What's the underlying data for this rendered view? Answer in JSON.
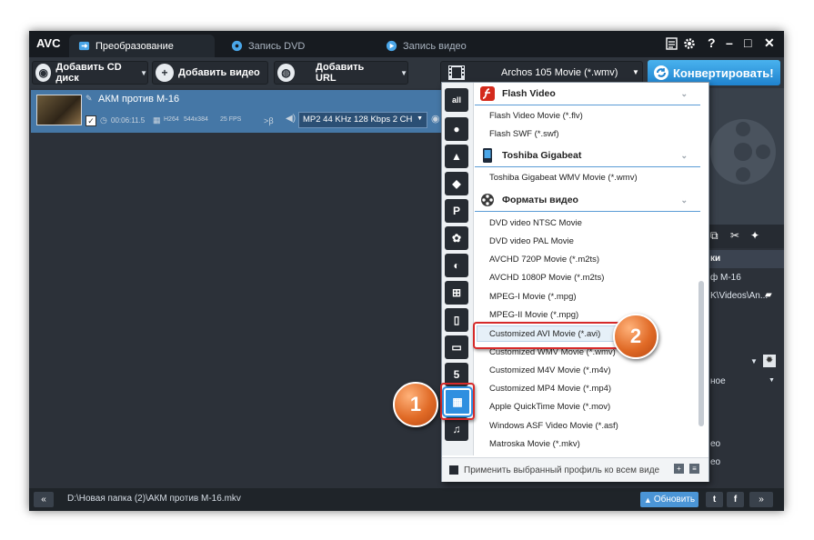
{
  "app": {
    "logo": "AVC",
    "tabs": [
      {
        "label": "Преобразование",
        "icon": "convert-icon",
        "active": true
      },
      {
        "label": "Запись DVD",
        "icon": "disc-icon",
        "active": false
      },
      {
        "label": "Запись видео",
        "icon": "play-icon",
        "active": false
      }
    ],
    "window_controls": {
      "help": "?",
      "minimize": "–",
      "maximize": "□",
      "close": "✕"
    }
  },
  "toolbar": {
    "add_cd": "Добавить CD диск",
    "add_video": "Добавить видео",
    "add_url": "Добавить URL",
    "profile": "Archos 105 Movie (*.wmv)",
    "convert": "Конвертировать!"
  },
  "file": {
    "name": "АКМ против М-16",
    "duration": "00:06:11.5",
    "codec": "H264",
    "resolution": "544x384",
    "fps": "25 FPS",
    "audio": "MP2 44 KHz 128 Kbps 2 CH"
  },
  "right_panel": {
    "header": "ки",
    "name_value": "ф М-16",
    "path_value": "K\\Videos\\An...",
    "option_value": "ное",
    "label_1": "ео",
    "label_2": "ео"
  },
  "dropdown": {
    "groups": [
      {
        "label": "Flash Video",
        "items": [
          "Flash Video Movie (*.flv)",
          "Flash SWF (*.swf)"
        ]
      },
      {
        "label": "Toshiba Gigabeat",
        "items": [
          "Toshiba Gigabeat WMV Movie (*.wmv)"
        ]
      },
      {
        "label": "Форматы видео",
        "items": [
          "DVD video NTSC Movie",
          "DVD video PAL Movie",
          "AVCHD 720P Movie (*.m2ts)",
          "AVCHD 1080P Movie (*.m2ts)",
          "MPEG-I Movie (*.mpg)",
          "MPEG-II Movie (*.mpg)",
          "Customized AVI Movie (*.avi)",
          "Customized WMV Movie (*.wmv)",
          "Customized M4V Movie (*.m4v)",
          "Customized MP4 Movie (*.mp4)",
          "Apple QuickTime Movie (*.mov)",
          "Windows ASF Video Movie (*.asf)",
          "Matroska Movie (*.mkv)"
        ]
      }
    ],
    "categories": [
      "all-icon",
      "apple-icon",
      "android-icon",
      "android-icon-2",
      "playstation-icon",
      "huawei-icon",
      "lg-icon",
      "windows-icon",
      "phone-icon",
      "tv-icon",
      "html5-icon",
      "film-icon",
      "music-icon"
    ],
    "footer": "Применить выбранный профиль ко всем виде"
  },
  "status": {
    "path": "D:\\Новая папка (2)\\АКМ против М-16.mkv",
    "update": "Обновить"
  },
  "annotations": {
    "one": "1",
    "two": "2"
  },
  "colors": {
    "accent": "#2f8fe0",
    "highlight_box": "#d62a2a",
    "callout": "#e06a26"
  }
}
